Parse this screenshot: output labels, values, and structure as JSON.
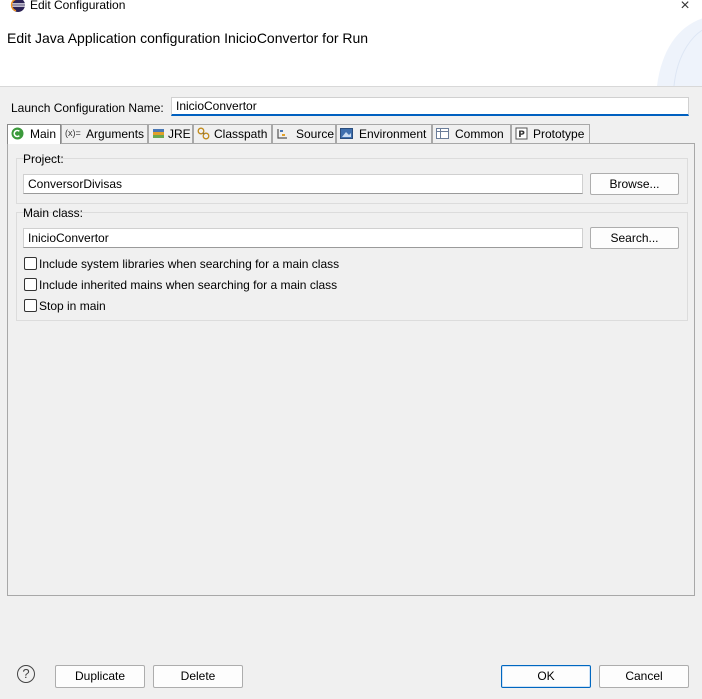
{
  "window": {
    "title": "Edit Configuration",
    "close_icon": "×"
  },
  "header": {
    "title": "Edit Java Application configuration InicioConvertor for Run"
  },
  "launch": {
    "name_label": "Launch Configuration Name:",
    "name_value": "InicioConvertor"
  },
  "tabs": [
    {
      "label": "Main",
      "icon": "main-tab-icon"
    },
    {
      "label": "Arguments",
      "icon": "arguments-icon"
    },
    {
      "label": "JRE",
      "icon": "jre-icon"
    },
    {
      "label": "Classpath",
      "icon": "classpath-icon"
    },
    {
      "label": "Source",
      "icon": "source-icon"
    },
    {
      "label": "Environment",
      "icon": "environment-icon"
    },
    {
      "label": "Common",
      "icon": "common-icon"
    },
    {
      "label": "Prototype",
      "icon": "prototype-icon"
    }
  ],
  "main": {
    "project": {
      "label": "Project:",
      "value": "ConversorDivisas",
      "button": "Browse..."
    },
    "main_class": {
      "label": "Main class:",
      "value": "InicioConvertor",
      "button": "Search..."
    },
    "options": [
      {
        "label": "Include system libraries when searching for a main class",
        "checked": false
      },
      {
        "label": "Include inherited mains when searching for a main class",
        "checked": false
      },
      {
        "label": "Stop in main",
        "checked": false
      }
    ]
  },
  "footer": {
    "help_label": "?",
    "duplicate": "Duplicate",
    "delete": "Delete",
    "ok": "OK",
    "cancel": "Cancel"
  },
  "colors": {
    "accent": "#0060c0",
    "background": "#f0f0f0"
  }
}
